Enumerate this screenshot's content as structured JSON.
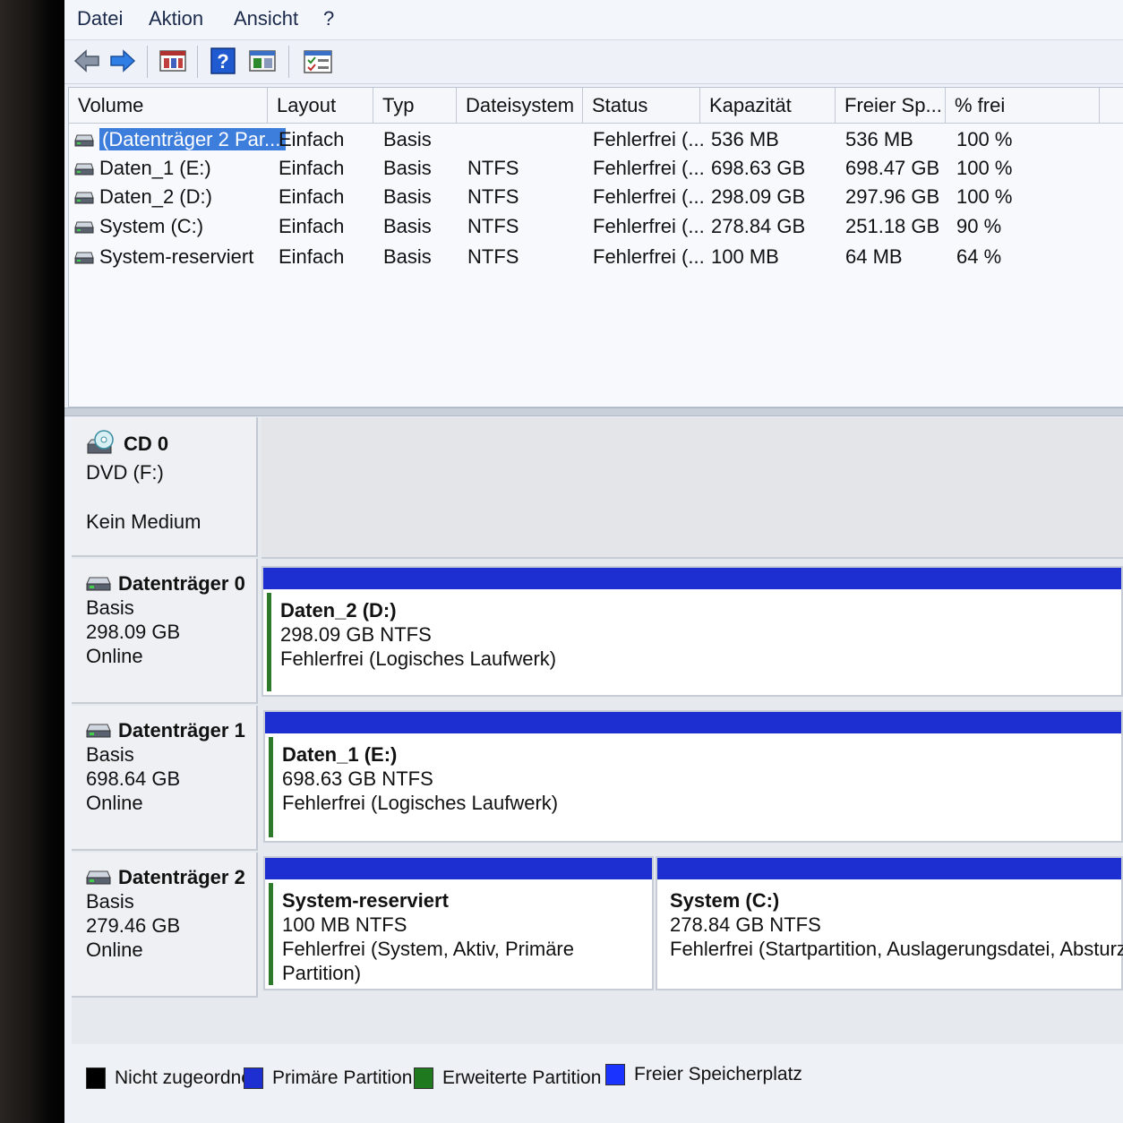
{
  "menu": [
    "Datei",
    "Aktion",
    "Ansicht",
    "?"
  ],
  "columns": [
    "Volume",
    "Layout",
    "Typ",
    "Dateisystem",
    "Status",
    "Kapazität",
    "Freier Sp...",
    "% frei"
  ],
  "volumes": [
    {
      "name": "(Datenträger 2 Par...",
      "layout": "Einfach",
      "typ": "Basis",
      "fs": "",
      "status": "Fehlerfrei (...",
      "cap": "536 MB",
      "free": "536 MB",
      "pct": "100 %"
    },
    {
      "name": "Daten_1 (E:)",
      "layout": "Einfach",
      "typ": "Basis",
      "fs": "NTFS",
      "status": "Fehlerfrei (...",
      "cap": "698.63 GB",
      "free": "698.47 GB",
      "pct": "100 %"
    },
    {
      "name": "Daten_2 (D:)",
      "layout": "Einfach",
      "typ": "Basis",
      "fs": "NTFS",
      "status": "Fehlerfrei (...",
      "cap": "298.09 GB",
      "free": "297.96 GB",
      "pct": "100 %"
    },
    {
      "name": "System (C:)",
      "layout": "Einfach",
      "typ": "Basis",
      "fs": "NTFS",
      "status": "Fehlerfrei (...",
      "cap": "278.84 GB",
      "free": "251.18 GB",
      "pct": "90 %"
    },
    {
      "name": "System-reserviert",
      "layout": "Einfach",
      "typ": "Basis",
      "fs": "NTFS",
      "status": "Fehlerfrei (...",
      "cap": "100 MB",
      "free": "64 MB",
      "pct": "64 %"
    }
  ],
  "cd": {
    "title": "CD 0",
    "line1": "DVD (F:)",
    "line2": "Kein Medium"
  },
  "disks": [
    {
      "title": "Datenträger 0",
      "type": "Basis",
      "size": "298.09 GB",
      "state": "Online",
      "parts": [
        {
          "name": "Daten_2  (D:)",
          "size": "298.09 GB NTFS",
          "status": "Fehlerfrei (Logisches Laufwerk)"
        }
      ]
    },
    {
      "title": "Datenträger 1",
      "type": "Basis",
      "size": "698.64 GB",
      "state": "Online",
      "parts": [
        {
          "name": "Daten_1  (E:)",
          "size": "698.63 GB NTFS",
          "status": "Fehlerfrei (Logisches Laufwerk)"
        }
      ]
    },
    {
      "title": "Datenträger 2",
      "type": "Basis",
      "size": "279.46 GB",
      "state": "Online",
      "parts": [
        {
          "name": "System-reserviert",
          "size": "100 MB NTFS",
          "status": "Fehlerfrei (System, Aktiv, Primäre Partition)"
        },
        {
          "name": "System  (C:)",
          "size": "278.84 GB NTFS",
          "status": "Fehlerfrei (Startpartition, Auslagerungsdatei, Absturzabbild)"
        }
      ]
    }
  ],
  "legend": [
    {
      "label": "Nicht zugeordnet",
      "color": "#000000"
    },
    {
      "label": "Primäre Partition",
      "color": "#1e2fd1"
    },
    {
      "label": "Erweiterte Partition",
      "color": "#1f7a1f"
    },
    {
      "label": "Freier Speicherplatz",
      "color": "#1a33ff"
    }
  ],
  "colors": {
    "selection": "#3d7ddc",
    "partition_band": "#1e2fd1",
    "logical_border": "#2c7a2a"
  }
}
